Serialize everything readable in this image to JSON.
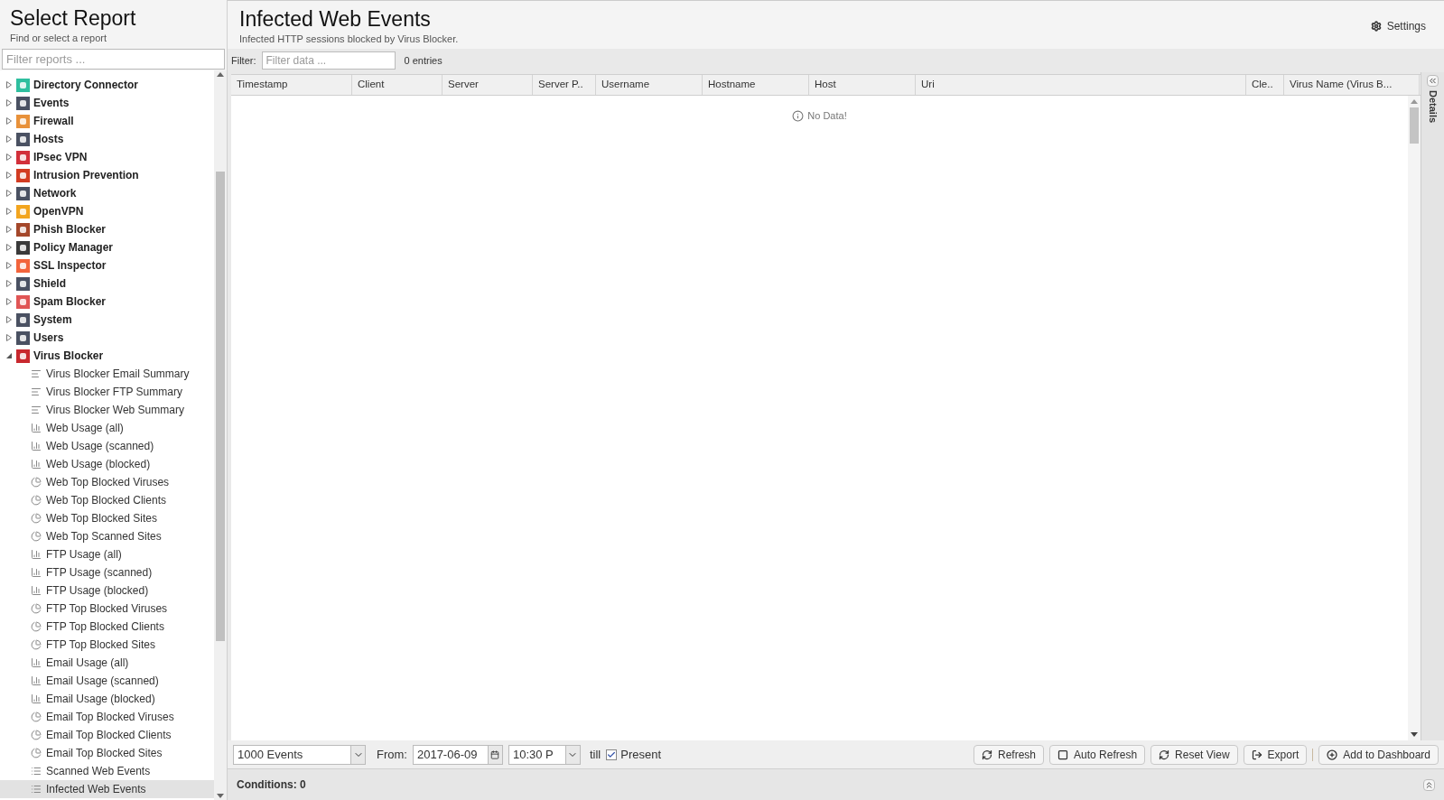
{
  "sidebar": {
    "title": "Select Report",
    "subtitle": "Find or select a report",
    "search": {
      "placeholder": "Filter reports ..."
    },
    "tree": [
      {
        "label": "Directory Connector",
        "color": "#2fbf9f",
        "expanded": false
      },
      {
        "label": "Events",
        "color": "#4a5162",
        "expanded": false
      },
      {
        "label": "Firewall",
        "color": "#e8913a",
        "expanded": false
      },
      {
        "label": "Hosts",
        "color": "#4a5162",
        "expanded": false
      },
      {
        "label": "IPsec VPN",
        "color": "#d2303a",
        "expanded": false
      },
      {
        "label": "Intrusion Prevention",
        "color": "#d23c22",
        "expanded": false
      },
      {
        "label": "Network",
        "color": "#4a5162",
        "expanded": false
      },
      {
        "label": "OpenVPN",
        "color": "#f2a51f",
        "expanded": false
      },
      {
        "label": "Phish Blocker",
        "color": "#a4472a",
        "expanded": false
      },
      {
        "label": "Policy Manager",
        "color": "#3a3a3a",
        "expanded": false
      },
      {
        "label": "SSL Inspector",
        "color": "#f2643c",
        "expanded": false
      },
      {
        "label": "Shield",
        "color": "#4a5162",
        "expanded": false
      },
      {
        "label": "Spam Blocker",
        "color": "#e05555",
        "expanded": false
      },
      {
        "label": "System",
        "color": "#4a5162",
        "expanded": false
      },
      {
        "label": "Users",
        "color": "#4a5162",
        "expanded": false
      },
      {
        "label": "Virus Blocker",
        "color": "#c8282e",
        "expanded": true,
        "children": [
          {
            "label": "Virus Blocker Email Summary",
            "kind": "text",
            "selected": false
          },
          {
            "label": "Virus Blocker FTP Summary",
            "kind": "text",
            "selected": false
          },
          {
            "label": "Virus Blocker Web Summary",
            "kind": "text",
            "selected": false
          },
          {
            "label": "Web Usage (all)",
            "kind": "bar",
            "selected": false
          },
          {
            "label": "Web Usage (scanned)",
            "kind": "bar",
            "selected": false
          },
          {
            "label": "Web Usage (blocked)",
            "kind": "bar",
            "selected": false
          },
          {
            "label": "Web Top Blocked Viruses",
            "kind": "pie",
            "selected": false
          },
          {
            "label": "Web Top Blocked Clients",
            "kind": "pie",
            "selected": false
          },
          {
            "label": "Web Top Blocked Sites",
            "kind": "pie",
            "selected": false
          },
          {
            "label": "Web Top Scanned Sites",
            "kind": "pie",
            "selected": false
          },
          {
            "label": "FTP Usage (all)",
            "kind": "bar",
            "selected": false
          },
          {
            "label": "FTP Usage (scanned)",
            "kind": "bar",
            "selected": false
          },
          {
            "label": "FTP Usage (blocked)",
            "kind": "bar",
            "selected": false
          },
          {
            "label": "FTP Top Blocked Viruses",
            "kind": "pie",
            "selected": false
          },
          {
            "label": "FTP Top Blocked Clients",
            "kind": "pie",
            "selected": false
          },
          {
            "label": "FTP Top Blocked Sites",
            "kind": "pie",
            "selected": false
          },
          {
            "label": "Email Usage (all)",
            "kind": "bar",
            "selected": false
          },
          {
            "label": "Email Usage (scanned)",
            "kind": "bar",
            "selected": false
          },
          {
            "label": "Email Usage (blocked)",
            "kind": "bar",
            "selected": false
          },
          {
            "label": "Email Top Blocked Viruses",
            "kind": "pie",
            "selected": false
          },
          {
            "label": "Email Top Blocked Clients",
            "kind": "pie",
            "selected": false
          },
          {
            "label": "Email Top Blocked Sites",
            "kind": "pie",
            "selected": false
          },
          {
            "label": "Scanned Web Events",
            "kind": "list",
            "selected": false
          },
          {
            "label": "Infected Web Events",
            "kind": "list",
            "selected": true
          }
        ]
      }
    ]
  },
  "report": {
    "title": "Infected Web Events",
    "subtitle": "Infected HTTP sessions blocked by Virus Blocker.",
    "settings": "Settings",
    "filter": {
      "label": "Filter:",
      "placeholder": "Filter data ...",
      "count": "0 entries"
    },
    "table": {
      "columns": [
        "Timestamp",
        "Client",
        "Server",
        "Server P..",
        "Username",
        "Hostname",
        "Host",
        "Uri",
        "Cle..",
        "Virus Name (Virus B..."
      ],
      "empty": "No Data!"
    },
    "details": "Details",
    "toolbar": {
      "limit": "1000 Events",
      "from": "From:",
      "date": "2017-06-09",
      "time": "10:30 P",
      "till": "till",
      "present": {
        "label": "Present",
        "checked": true
      },
      "buttons": [
        {
          "label": "Refresh",
          "kind": "refresh"
        },
        {
          "label": "Auto Refresh",
          "kind": "toggle"
        },
        {
          "label": "Reset View",
          "kind": "refresh"
        },
        {
          "label": "Export",
          "kind": "export"
        },
        {
          "label": "Add to Dashboard",
          "kind": "add"
        }
      ]
    },
    "conditions": "Conditions: 0"
  }
}
